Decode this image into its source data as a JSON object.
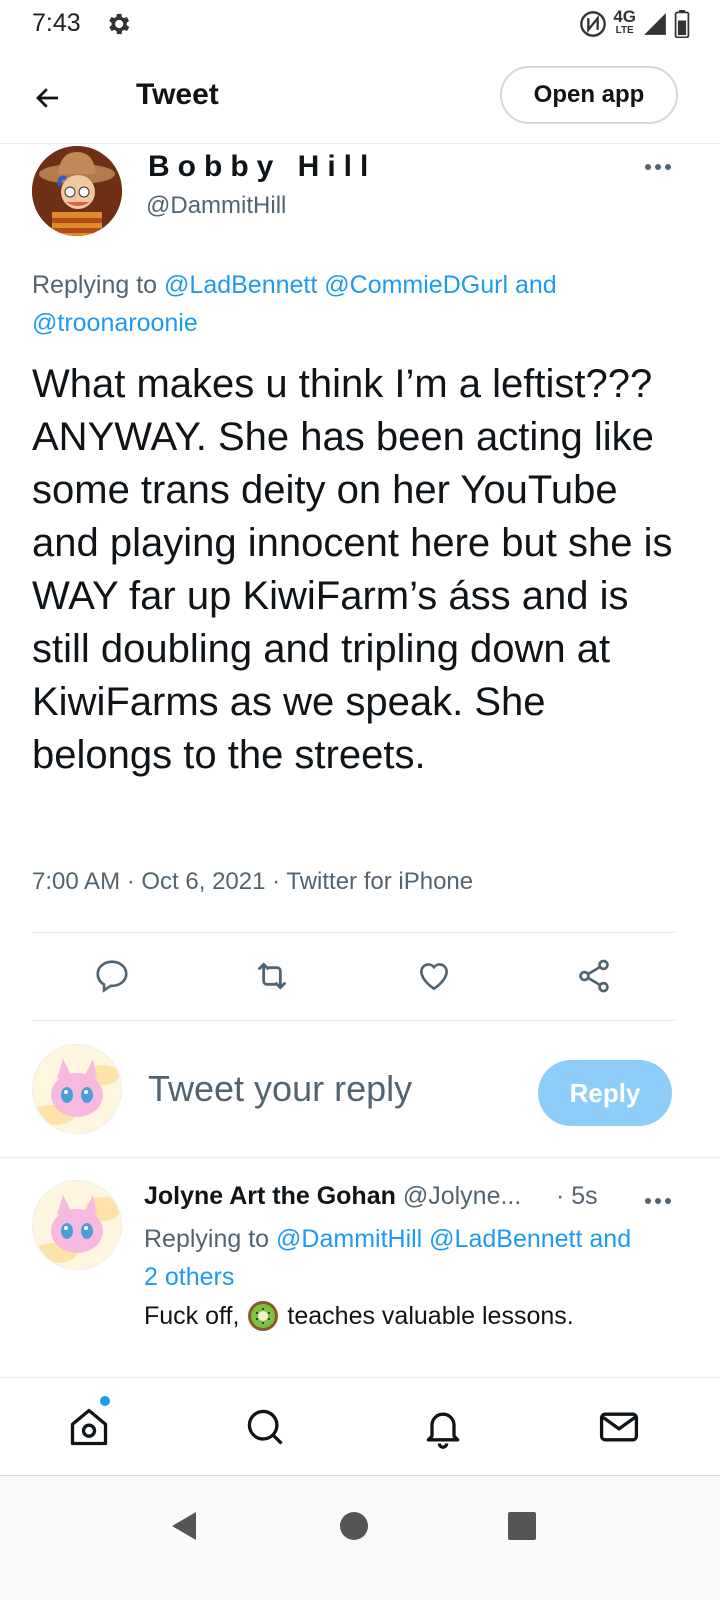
{
  "status_bar": {
    "time": "7:43",
    "network_label": "4G",
    "network_sub": "LTE"
  },
  "header": {
    "title": "Tweet",
    "open_app_label": "Open app"
  },
  "tweet": {
    "author_name": "Bobby Hill",
    "author_handle": "@DammitHill",
    "reply_prefix": "Replying to ",
    "mentions": [
      "@LadBennett",
      "@CommieDGurl"
    ],
    "mention_join": " and ",
    "mention_last": "@troonaroonie",
    "text": "What makes u think I’m a leftist??? ANYWAY. She has been acting like some trans deity on her YouTube and playing innocent here but she is WAY far up KiwiFarm’s áss and is still doubling and tripling down at KiwiFarms as we speak. She belongs to the streets.",
    "meta": "7:00 AM · Oct 6, 2021 · Twitter for iPhone"
  },
  "composer": {
    "placeholder": "Tweet your reply",
    "reply_label": "Reply"
  },
  "reply": {
    "name": "Jolyne Art the Gohan",
    "handle": "@Jolyne...",
    "time": "· 5s",
    "context_prefix": "Replying to ",
    "context_mentions": "@DammitHill @LadBennett",
    "context_and": " and",
    "context_others": "2 others",
    "text_before": "Fuck off,",
    "text_after": "teaches valuable lessons."
  },
  "colors": {
    "accent": "#1d9bf0",
    "reply_button": "#8ecdf7",
    "secondary_text": "#536471",
    "divider": "#e6ecf0"
  },
  "icons": {
    "status": [
      "gear-icon",
      "nfc-icon",
      "signal-icon",
      "battery-icon"
    ],
    "tweet_actions": [
      "comment-icon",
      "retweet-icon",
      "like-icon",
      "share-icon"
    ],
    "bottom_nav": [
      "home-icon",
      "search-icon",
      "bell-icon",
      "mail-icon"
    ],
    "system_nav": [
      "back-triangle-icon",
      "home-circle-icon",
      "recents-square-icon"
    ]
  }
}
